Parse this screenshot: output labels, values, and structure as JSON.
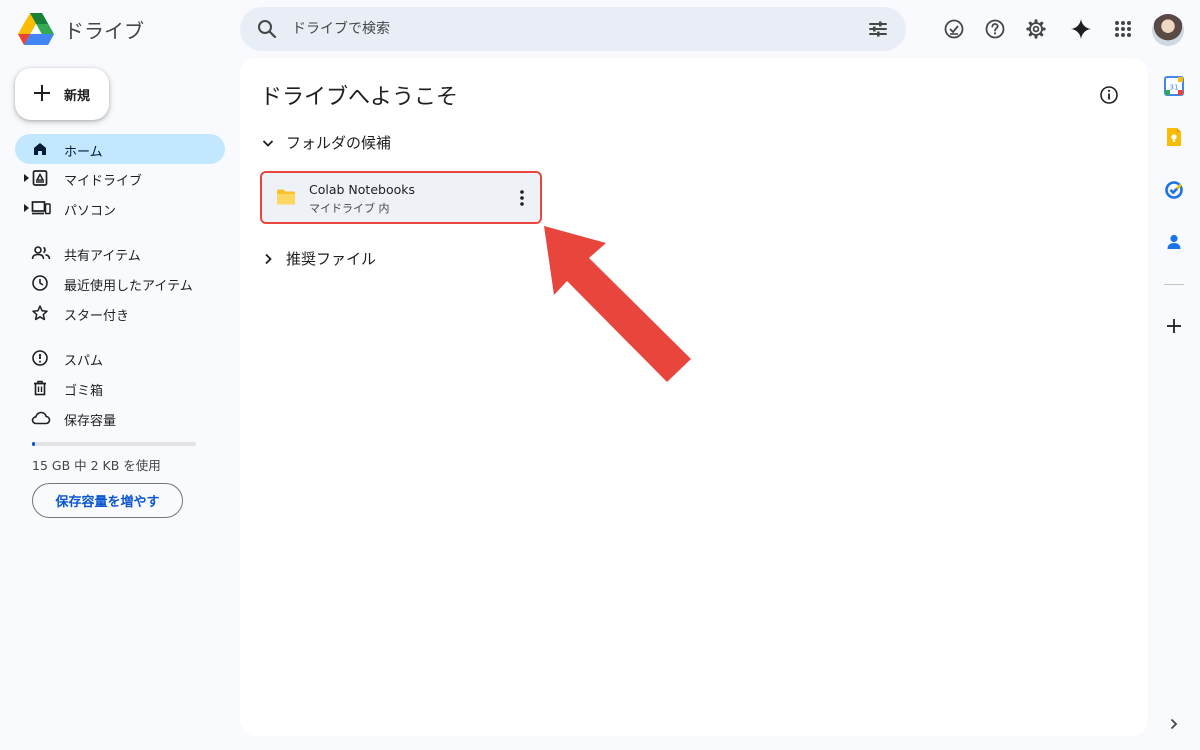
{
  "app": {
    "title": "ドライブ"
  },
  "search": {
    "placeholder": "ドライブで検索"
  },
  "header_icons": [
    "ready-for-offline-icon",
    "help-icon",
    "settings-icon",
    "gemini-icon",
    "apps-icon"
  ],
  "sidebar": {
    "new_label": "新規",
    "items": [
      {
        "label": "ホーム",
        "icon": "home-icon",
        "active": true
      },
      {
        "label": "マイドライブ",
        "icon": "my-drive-icon",
        "expandable": true
      },
      {
        "label": "パソコン",
        "icon": "computers-icon",
        "expandable": true
      },
      {
        "label": "共有アイテム",
        "icon": "shared-icon"
      },
      {
        "label": "最近使用したアイテム",
        "icon": "clock-icon"
      },
      {
        "label": "スター付き",
        "icon": "star-icon"
      },
      {
        "label": "スパム",
        "icon": "spam-icon"
      },
      {
        "label": "ゴミ箱",
        "icon": "trash-icon"
      },
      {
        "label": "保存容量",
        "icon": "cloud-icon"
      }
    ],
    "storage": {
      "text": "15 GB 中 2 KB を使用",
      "used_fraction": 0.02,
      "buy_label": "保存容量を増やす"
    }
  },
  "main": {
    "title": "ドライブへようこそ",
    "suggested_folders": {
      "label": "フォルダの候補",
      "folders": [
        {
          "name": "Colab Notebooks",
          "location": "マイドライブ 内"
        }
      ]
    },
    "suggested_files": {
      "label": "推奨ファイル"
    }
  },
  "side_panel_icons": [
    "calendar-icon",
    "keep-icon",
    "tasks-icon",
    "contacts-icon",
    "add-addon-icon"
  ],
  "calendar_day": "31",
  "colors": {
    "accent": "#0b57d0",
    "active_nav": "#c2e7ff",
    "annotation": "#e8453c",
    "folder": "#fbc02d"
  }
}
